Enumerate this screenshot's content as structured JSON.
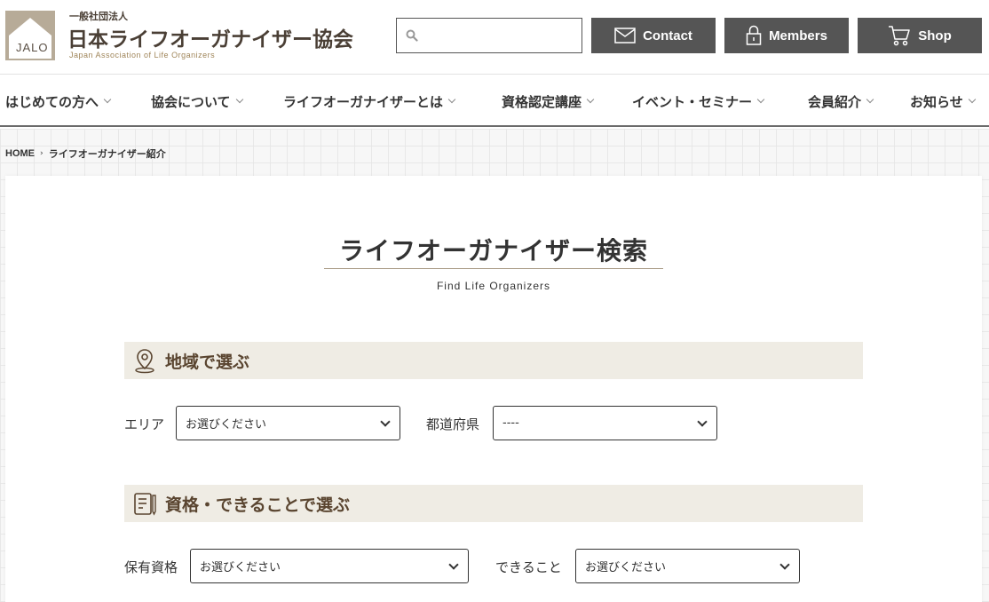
{
  "header": {
    "logo_text": "JALO",
    "org_type": "一般社団法人",
    "org_name": "日本ライフオーガナイザー協会",
    "org_name_en": "Japan Association of Life Organizers",
    "search": {
      "value": "",
      "placeholder": ""
    },
    "buttons": {
      "contact": "Contact",
      "members": "Members",
      "shop": "Shop"
    }
  },
  "nav": {
    "items": [
      {
        "label": "はじめての方へ"
      },
      {
        "label": "協会について"
      },
      {
        "label": "ライフオーガナイザーとは"
      },
      {
        "label": "資格認定講座"
      },
      {
        "label": "イベント・セミナー"
      },
      {
        "label": "会員紹介"
      },
      {
        "label": "お知らせ"
      }
    ]
  },
  "breadcrumb": {
    "home": "HOME",
    "separator": "›",
    "current": "ライフオーガナイザー紹介"
  },
  "main": {
    "title": "ライフオーガナイザー検索",
    "subtitle": "Find Life Organizers",
    "section_area": {
      "title": "地域で選ぶ",
      "area_label": "エリア",
      "area_value": "お選びください",
      "pref_label": "都道府県",
      "pref_value": "----"
    },
    "section_qual": {
      "title": "資格・できることで選ぶ",
      "qual_label": "保有資格",
      "qual_value": "お選びください",
      "can_label": "できること",
      "can_value": "お選びください"
    }
  },
  "colors": {
    "button_bg": "#555555",
    "section_bg": "#efece4",
    "section_title": "#5a4530",
    "logo_bg": "#b7ab98"
  }
}
